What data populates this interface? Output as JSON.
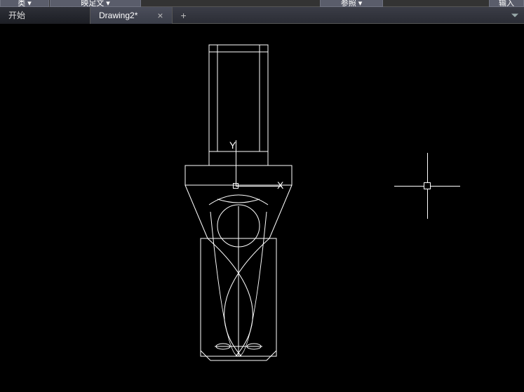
{
  "menubar": {
    "item1_label": "类",
    "item1_caret": "▾",
    "item2_label": "映足文",
    "item2_caret": "▾",
    "item3_label": "参照",
    "item3_caret": "▾",
    "item4_label": "输入"
  },
  "tabs": {
    "start_label": "开始",
    "drawing_label": "Drawing2*",
    "close_glyph": "×",
    "add_glyph": "+"
  },
  "ucs": {
    "x_label": "X",
    "y_label": "Y"
  }
}
